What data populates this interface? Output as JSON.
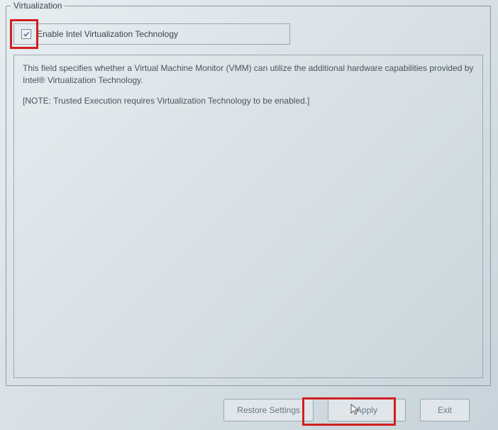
{
  "fieldset": {
    "legend": "Virtualization"
  },
  "option": {
    "label": "Enable Intel Virtualization Technology",
    "checked": true
  },
  "description": {
    "line1": "This field specifies whether a Virtual Machine Monitor (VMM) can utilize the additional hardware capabilities provided by Intel® Virtualization Technology.",
    "note": "[NOTE: Trusted Execution requires Virtualization Technology to be enabled.]"
  },
  "buttons": {
    "restore": "Restore Settings",
    "apply": "Apply",
    "exit": "Exit"
  }
}
